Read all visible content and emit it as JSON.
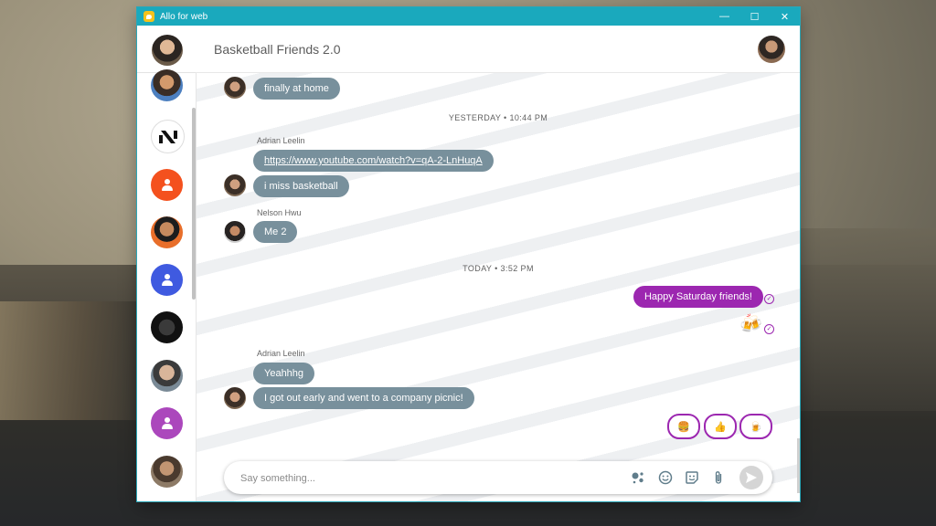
{
  "window": {
    "title": "Allo for web",
    "controls": {
      "minimize": "—",
      "maximize": "☐",
      "close": "✕"
    }
  },
  "header": {
    "chat_title": "Basketball Friends 2.0"
  },
  "sidebar": {
    "chats": [
      {
        "kind": "photo",
        "color": "#b87a3c"
      },
      {
        "kind": "logo",
        "color": "#ffffff"
      },
      {
        "kind": "placeholder",
        "color": "#f4511e"
      },
      {
        "kind": "photo",
        "color": "#c86b3a"
      },
      {
        "kind": "placeholder",
        "color": "#3f5ae0"
      },
      {
        "kind": "photo",
        "color": "#1a1a1a"
      },
      {
        "kind": "photo",
        "color": "#7a8a96"
      },
      {
        "kind": "placeholder",
        "color": "#ab47bc"
      },
      {
        "kind": "photo",
        "color": "#6c5442"
      }
    ]
  },
  "messages": {
    "m1": "finally at home",
    "divider1": "YESTERDAY • 10:44 PM",
    "sender_adrian_1": "Adrian Leelin",
    "m2": "https://www.youtube.com/watch?v=qA-2-LnHuqA",
    "m3": "i miss basketball",
    "sender_nelson": "Nelson Hwu",
    "m4": "Me 2",
    "divider2": "TODAY • 3:52 PM",
    "m5": "Happy Saturday friends!",
    "m6_sticker": "🍻",
    "sender_adrian_2": "Adrian Leelin",
    "m7": "Yeahhhg",
    "m8": "I got out early and went to a company picnic!"
  },
  "smart_replies": [
    "🍔",
    "👍",
    "🍺"
  ],
  "composer": {
    "placeholder": "Say something...",
    "icons": [
      "assistant-icon",
      "emoji-icon",
      "sticker-icon",
      "attach-icon",
      "send-icon"
    ]
  },
  "colors": {
    "titlebar": "#1aa9bd",
    "bubble_incoming": "#78909c",
    "bubble_outgoing": "#9c27b0"
  }
}
